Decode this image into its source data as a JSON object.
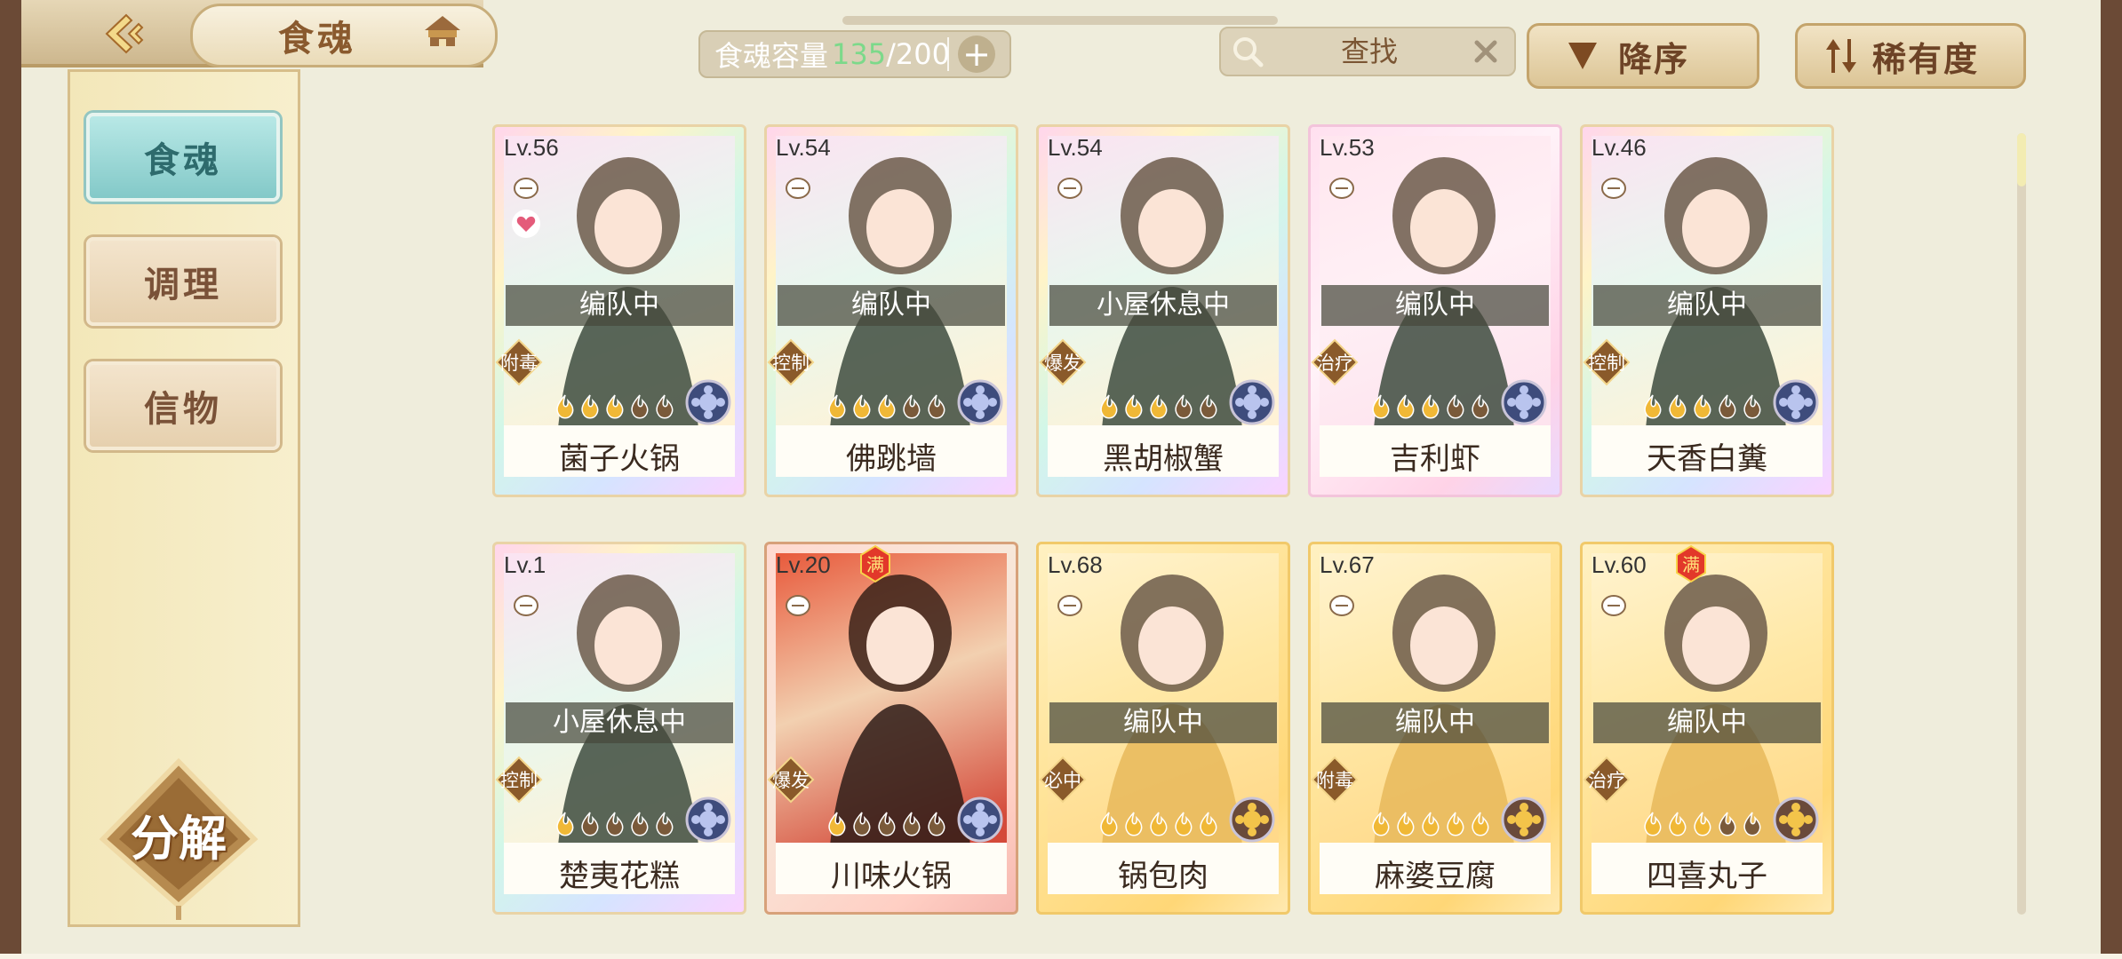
{
  "header": {
    "title": "食魂",
    "capacity_label": "食魂容量",
    "capacity_used": "135",
    "capacity_separator": "/",
    "capacity_total": "200",
    "plus_label": "+",
    "search_placeholder": "查找",
    "sort_order_label": "降序",
    "sort_key_label": "稀有度"
  },
  "sidebar": {
    "items": [
      {
        "label": "食魂",
        "active": true
      },
      {
        "label": "调理",
        "active": false
      },
      {
        "label": "信物",
        "active": false
      }
    ],
    "decompose_label": "分解"
  },
  "cards": [
    {
      "level": "Lv.56",
      "status": "编队中",
      "role": "附毒",
      "name": "菌子火锅",
      "flames": 3,
      "rarity_bg": "rainbow",
      "heart": true,
      "full": false
    },
    {
      "level": "Lv.54",
      "status": "编队中",
      "role": "控制",
      "name": "佛跳墙",
      "flames": 3,
      "rarity_bg": "rainbow",
      "heart": false,
      "full": false
    },
    {
      "level": "Lv.54",
      "status": "小屋休息中",
      "role": "爆发",
      "name": "黑胡椒蟹",
      "flames": 3,
      "rarity_bg": "rainbow",
      "heart": false,
      "full": false
    },
    {
      "level": "Lv.53",
      "status": "编队中",
      "role": "治疗",
      "name": "吉利虾",
      "flames": 3,
      "rarity_bg": "pink",
      "heart": false,
      "full": false
    },
    {
      "level": "Lv.46",
      "status": "编队中",
      "role": "控制",
      "name": "天香白糞",
      "flames": 3,
      "rarity_bg": "rainbow",
      "heart": false,
      "full": false
    },
    {
      "level": "Lv.1",
      "status": "小屋休息中",
      "role": "控制",
      "name": "楚夷花糕",
      "flames": 1,
      "rarity_bg": "rainbow",
      "heart": false,
      "full": false
    },
    {
      "level": "Lv.20",
      "status": "",
      "role": "爆发",
      "name": "川味火锅",
      "flames": 1,
      "rarity_bg": "red",
      "heart": false,
      "full": true
    },
    {
      "level": "Lv.68",
      "status": "编队中",
      "role": "必中",
      "name": "锅包肉",
      "flames": 5,
      "rarity_bg": "gold",
      "heart": false,
      "full": false
    },
    {
      "level": "Lv.67",
      "status": "编队中",
      "role": "附毒",
      "name": "麻婆豆腐",
      "flames": 5,
      "rarity_bg": "gold",
      "heart": false,
      "full": false
    },
    {
      "level": "Lv.60",
      "status": "编队中",
      "role": "治疗",
      "name": "四喜丸子",
      "flames": 3,
      "rarity_bg": "gold",
      "heart": false,
      "full": true
    }
  ],
  "full_badge_label": "满",
  "colors": {
    "accent_teal": "#83c9c8",
    "brown_text": "#6d4326",
    "capacity_green": "#7cd98a",
    "role_badge": "#8a5a2a",
    "flame_lit": "#f0b836",
    "flame_dim": "#7a5a3a",
    "emblem_blue": "#3e4c7c"
  },
  "icons": [
    "back-arrow-icon",
    "house-icon",
    "search-icon",
    "close-icon",
    "sort-down-icon",
    "rarity-sort-icon",
    "pot-icon",
    "heart-icon",
    "flame-icon",
    "emblem-icon",
    "full-badge-icon"
  ]
}
